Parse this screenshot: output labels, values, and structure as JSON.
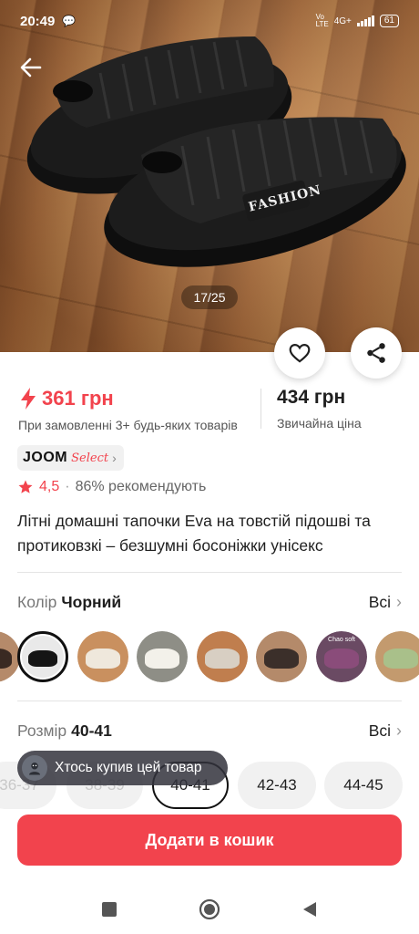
{
  "status_bar": {
    "time": "20:49",
    "network": "4G+",
    "battery": "61"
  },
  "gallery": {
    "counter": "17/25",
    "logo_text": "FASHION"
  },
  "price": {
    "discount_price": "361 грн",
    "discount_note": "При замовленні 3+ будь-яких товарів",
    "regular_price": "434 грн",
    "regular_note": "Звичайна ціна"
  },
  "badge": {
    "brand": "JOOM",
    "tag": "Select"
  },
  "rating": {
    "value": "4,5",
    "separator": "·",
    "recommend": "86% рекомендують"
  },
  "product": {
    "title": "Літні домашні тапочки Eva на товстій підошві та протиковзкі – безшумні босоніжки унісекс"
  },
  "color_option": {
    "label": "Колір",
    "selected": "Чорний",
    "all_label": "Всі",
    "swatch_text": "Chao soft"
  },
  "size_option": {
    "label": "Розмір",
    "selected": "40-41",
    "all_label": "Всі",
    "sizes": [
      "36-37",
      "38-39",
      "40-41",
      "42-43",
      "44-45"
    ]
  },
  "toast": {
    "text": "Хтось купив цей товар"
  },
  "cta": {
    "label": "Додати в кошик"
  },
  "colors": {
    "accent": "#f2434d",
    "dark": "#1f1f1f"
  }
}
